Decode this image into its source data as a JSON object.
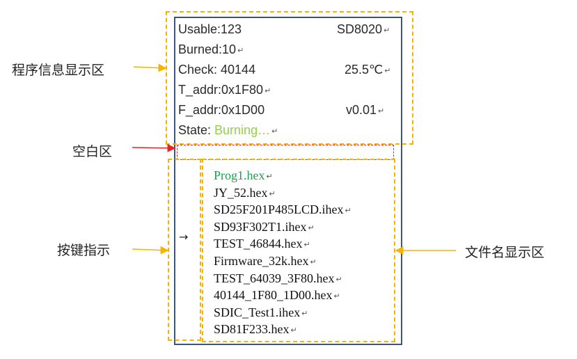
{
  "info": {
    "usable": "Usable:123",
    "device": "SD8020",
    "burned": "Burned:10",
    "check": "Check: 40144",
    "temperature": "25.5℃",
    "t_addr": "T_addr:0x1F80",
    "f_addr": "F_addr:0x1D00",
    "version": "v0.01",
    "state_label": "State: ",
    "state_value": "Burning…"
  },
  "return_mark": "↵",
  "key_pointer": "→",
  "files": [
    "Prog1.hex",
    "JY_52.hex",
    "SD25F201P485LCD.ihex",
    "SD93F302T1.ihex",
    "TEST_46844.hex",
    "Firmware_32k.hex",
    "TEST_64039_3F80.hex",
    "40144_1F80_1D00.hex",
    "SDIC_Test1.ihex",
    "SD81F233.hex"
  ],
  "selected_file_index": 0,
  "callouts": {
    "program_info": "程序信息显示区",
    "blank_area": "空白区",
    "key_indicator": "按键指示",
    "file_name_area": "文件名显示区"
  },
  "colors": {
    "frame": "#3f5577",
    "dashed_region": "#f5b400",
    "blank_region": "#e4262b",
    "selected_file": "#1aa24a",
    "state_value": "#92d050"
  }
}
